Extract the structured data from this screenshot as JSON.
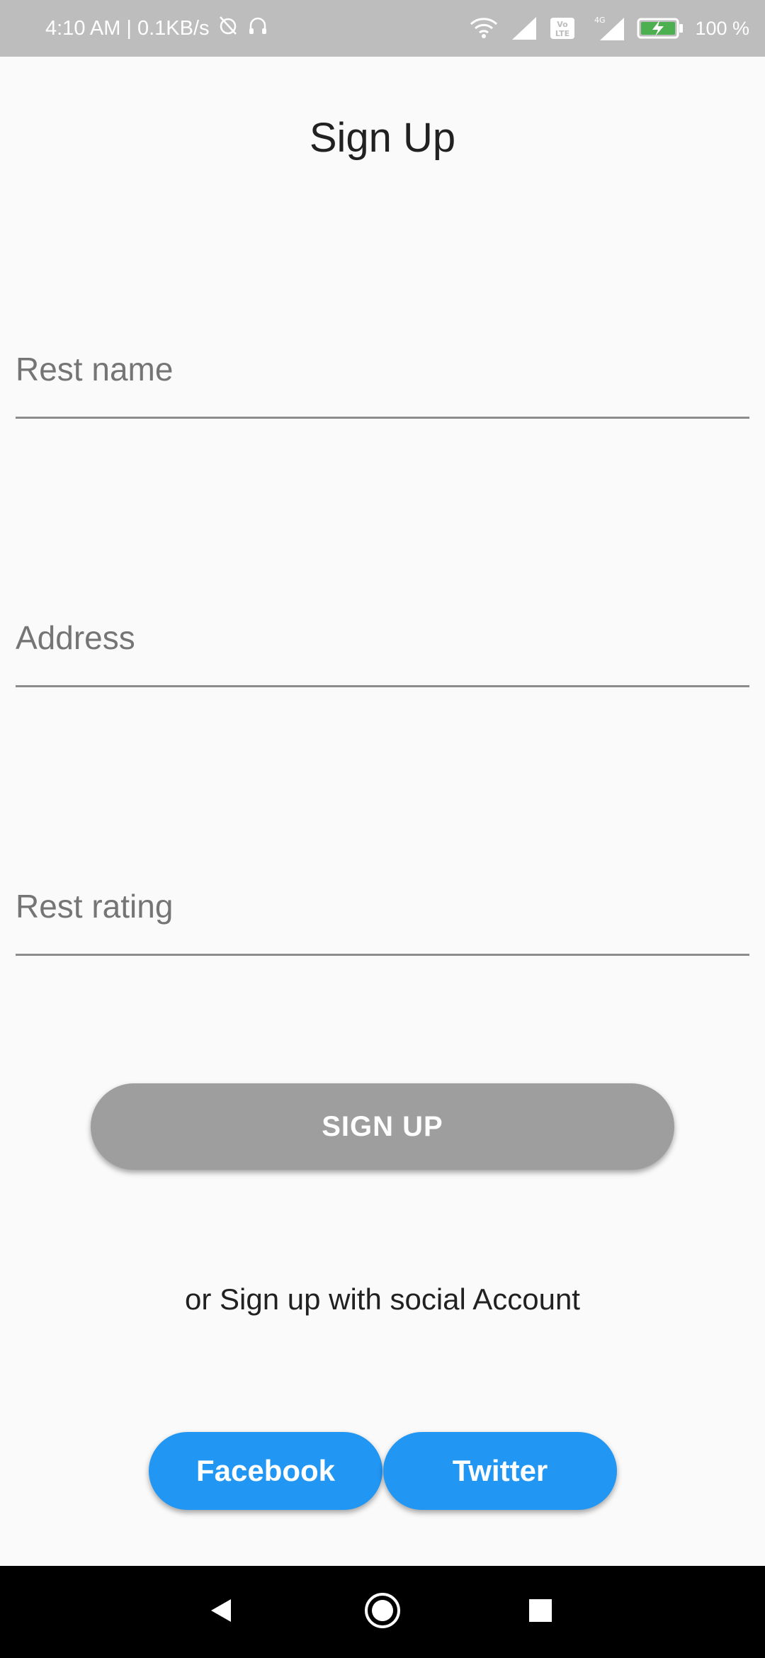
{
  "status_bar": {
    "time": "4:10 AM",
    "separator": "|",
    "net_speed": "0.1KB/s",
    "battery": "100 %",
    "icons": [
      "alarm-off-icon",
      "headset-icon",
      "wifi-icon",
      "signal-icon",
      "volte-icon",
      "4g-signal-icon",
      "battery-charging-icon"
    ]
  },
  "screen": {
    "title": "Sign Up"
  },
  "form": {
    "rest_name": {
      "placeholder": "Rest name",
      "value": ""
    },
    "address": {
      "placeholder": "Address",
      "value": ""
    },
    "rest_rating": {
      "placeholder": "Rest rating",
      "value": ""
    }
  },
  "actions": {
    "signup_label": "SIGN UP",
    "social_prompt": "or Sign up with social Account",
    "facebook_label": "Facebook",
    "twitter_label": "Twitter"
  },
  "nav": {
    "icons": [
      "back-icon",
      "home-icon",
      "recents-icon"
    ]
  },
  "colors": {
    "status_bar": "#bdbdbd",
    "background": "#fafafa",
    "signup_button": "#9e9e9e",
    "social_button": "#2196f3",
    "nav_bar": "#000000",
    "battery_fill": "#4caf50"
  }
}
